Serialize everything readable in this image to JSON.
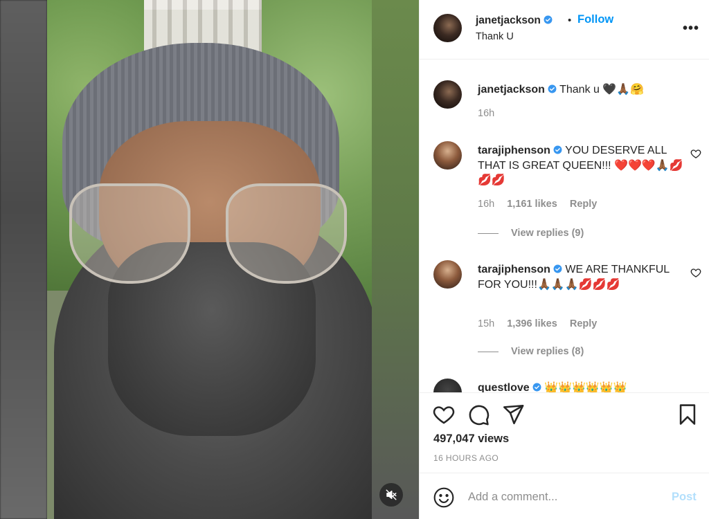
{
  "post": {
    "username": "janetjackson",
    "follow_label": "Follow",
    "dot": "•",
    "subtitle": "Thank U",
    "more_label": "•••"
  },
  "comments": [
    {
      "username": "janetjackson",
      "text": "Thank u 🖤🙏🏾🤗",
      "time": "16h"
    },
    {
      "username": "tarajiphenson",
      "text": "YOU DESERVE ALL THAT IS GREAT QUEEN!!! ❤️❤️❤️🙏🏾💋💋💋",
      "time": "16h",
      "likes": "1,161 likes",
      "reply_label": "Reply",
      "view_replies": "View replies (9)"
    },
    {
      "username": "tarajiphenson",
      "text": "WE ARE THANKFUL FOR YOU!!!🙏🏾🙏🏾🙏🏾💋💋💋",
      "time": "15h",
      "likes": "1,396 likes",
      "reply_label": "Reply",
      "view_replies": "View replies (8)"
    },
    {
      "username": "questlove",
      "text": "👑👑👑👑👑👑"
    }
  ],
  "stats": {
    "views": "497,047 views",
    "age": "16 HOURS AGO"
  },
  "add_comment": {
    "placeholder": "Add a comment...",
    "post_label": "Post"
  },
  "icons": {
    "like": "heart-icon",
    "comment": "comment-icon",
    "share": "paper-plane-icon",
    "save": "bookmark-icon",
    "emoji": "smiley-icon",
    "mute": "speaker-muted-icon",
    "verified": "verified-badge-icon"
  },
  "colors": {
    "accent": "#0095f6",
    "verified": "#3897f0",
    "muted_text": "#8e8e8e",
    "post_disabled": "#b2dffc"
  }
}
